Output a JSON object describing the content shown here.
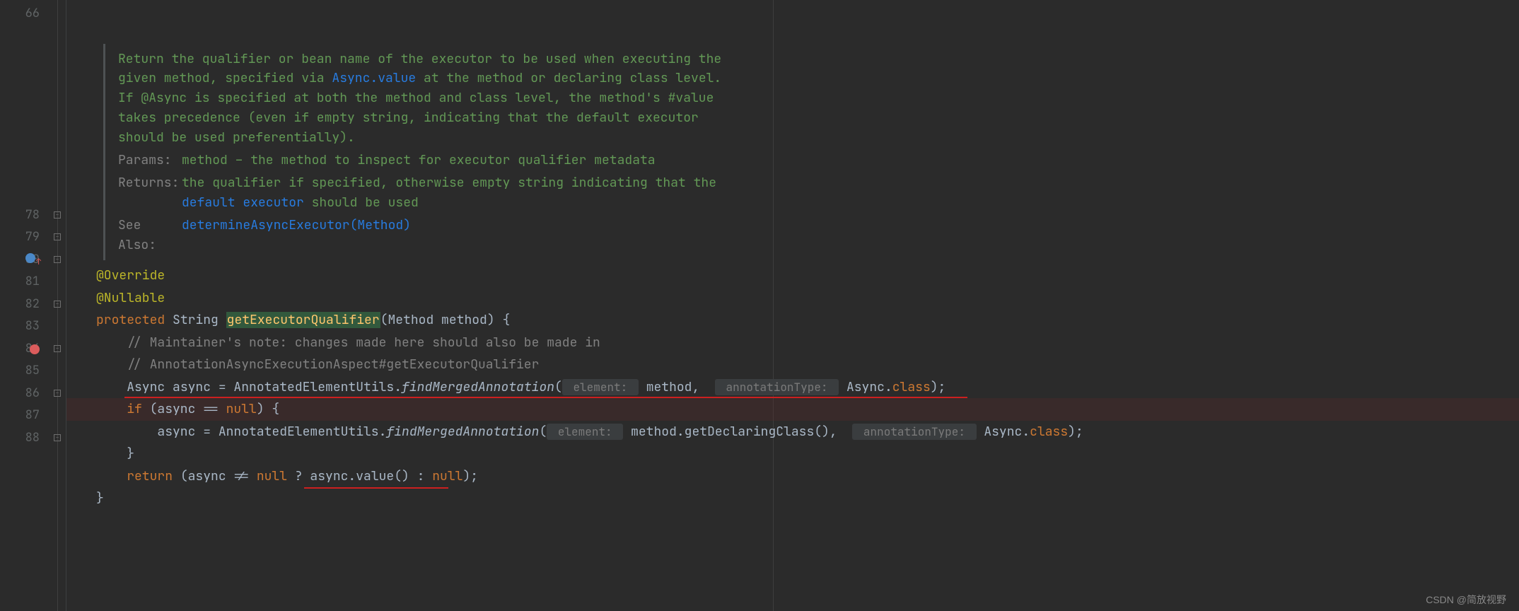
{
  "gutter": {
    "lines": [
      "66",
      "",
      "",
      "",
      "",
      "",
      "",
      "",
      "",
      "78",
      "79",
      "80",
      "81",
      "82",
      "83",
      "84",
      "85",
      "86",
      "87",
      "88"
    ],
    "breakpoint_line": "84",
    "override_line": "80"
  },
  "javadoc": {
    "summary_pre": "Return the qualifier or bean name of the executor to be used when executing the given method, specified via ",
    "summary_link": "Async.value",
    "summary_post": " at the method or declaring class level. If @Async is specified at both the method and class level, the method's #value takes precedence (even if empty string, indicating that the default executor should be used preferentially).",
    "params_label": "Params:",
    "params_value": "method – the method to inspect for executor qualifier metadata",
    "returns_label": "Returns:",
    "returns_pre": "the qualifier if specified, otherwise empty string indicating that the ",
    "returns_link": "default executor",
    "returns_post": " should be used",
    "seealso_label": "See Also:",
    "seealso_link": "determineAsyncExecutor(Method)"
  },
  "code": {
    "l78": {
      "anno": "@Override"
    },
    "l79": {
      "anno": "@Nullable"
    },
    "l80": {
      "kw": "protected",
      "type": "String",
      "name": "getExecutorQualifier",
      "params": "(Method method) {"
    },
    "l81": {
      "comment": "// Maintainer's note: changes made here should also be made in"
    },
    "l82": {
      "comment": "// AnnotationAsyncExecutionAspect#getExecutorQualifier"
    },
    "l83": {
      "type": "Async",
      "var": "async",
      "eq": " = ",
      "cls": "AnnotatedElementUtils",
      "dot": ".",
      "method": "findMergedAnnotation",
      "open": "(",
      "hint1": " element: ",
      "arg1": "method",
      "comma": ", ",
      "hint2": " annotationType: ",
      "arg2": "Async",
      "dotclass": ".",
      "classkw": "class",
      "close": ");"
    },
    "l84": {
      "kw": "if",
      "open": " (async == ",
      "null": "null",
      "close": ") {"
    },
    "l85": {
      "var": "async",
      "eq": " = ",
      "cls": "AnnotatedElementUtils",
      "dot": ".",
      "method": "findMergedAnnotation",
      "open": "(",
      "hint1": " element: ",
      "arg1": "method.getDeclaringClass()",
      "comma": ", ",
      "hint2": " annotationType: ",
      "arg2": "Async",
      "dotclass": ".",
      "classkw": "class",
      "close": ");"
    },
    "l86": {
      "close": "}"
    },
    "l87": {
      "kw": "return",
      "open": " (async != ",
      "null1": "null",
      "q": " ? async.value() : ",
      "null2": "null",
      "close": ");"
    },
    "l88": {
      "close": "}"
    }
  },
  "watermark": "CSDN @简放视野"
}
